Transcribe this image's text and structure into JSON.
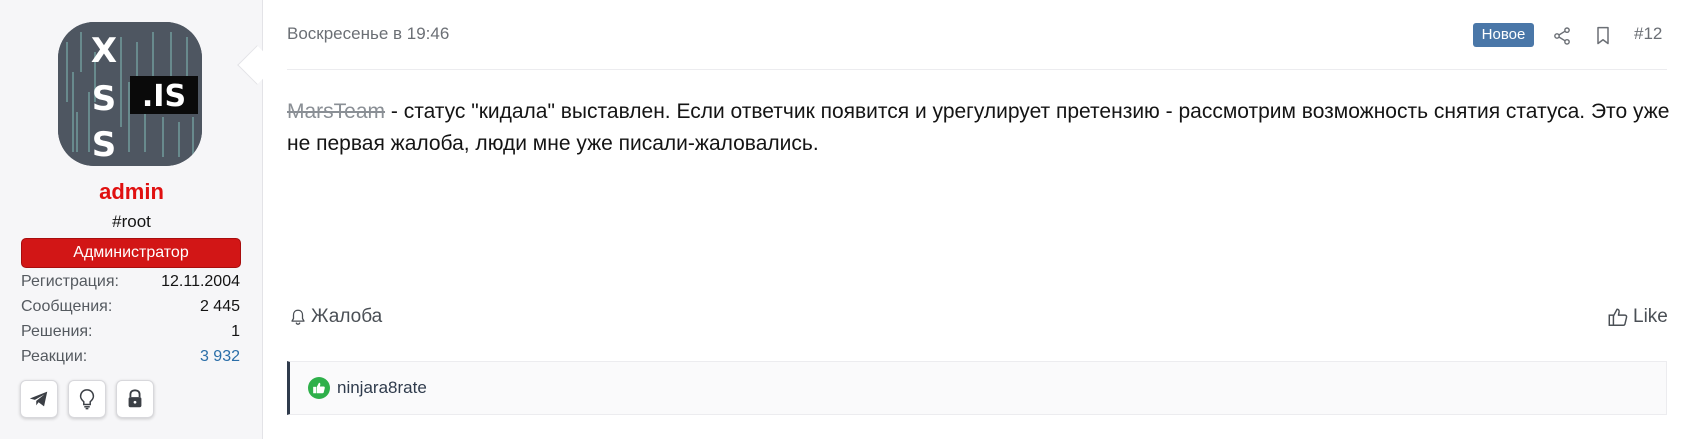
{
  "user": {
    "avatar_logo": {
      "letters": [
        "X",
        "S",
        "S"
      ],
      "domain": ".IS"
    },
    "name": "admin",
    "title": "#root",
    "banner": "Администратор",
    "stats": [
      {
        "label": "Регистрация:",
        "value": "12.11.2004"
      },
      {
        "label": "Сообщения:",
        "value": "2 445"
      },
      {
        "label": "Решения:",
        "value": "1"
      },
      {
        "label": "Реакции:",
        "value": "3 932"
      }
    ],
    "buttons": [
      "telegram-icon",
      "lightbulb-icon",
      "lock-icon"
    ]
  },
  "post": {
    "date": "Воскресенье в 19:46",
    "badge": "Новое",
    "number": "#12",
    "mention": "MarsTeam",
    "text": " - статус \"кидала\" выставлен. Если ответчик появится и урегулирует претензию - рассмотрим возможность снятия статуса. Это уже не первая жалоба, люди мне уже писали-жаловались."
  },
  "actions": {
    "report": "Жалоба",
    "like": "Like"
  },
  "reactions": {
    "user": "ninjara8rate"
  },
  "colors": {
    "username": "#e01010",
    "banner": "#d21616",
    "badge": "#4a77a8",
    "reaction": "#2eb04a",
    "avatar_bg": "#4e5661"
  }
}
